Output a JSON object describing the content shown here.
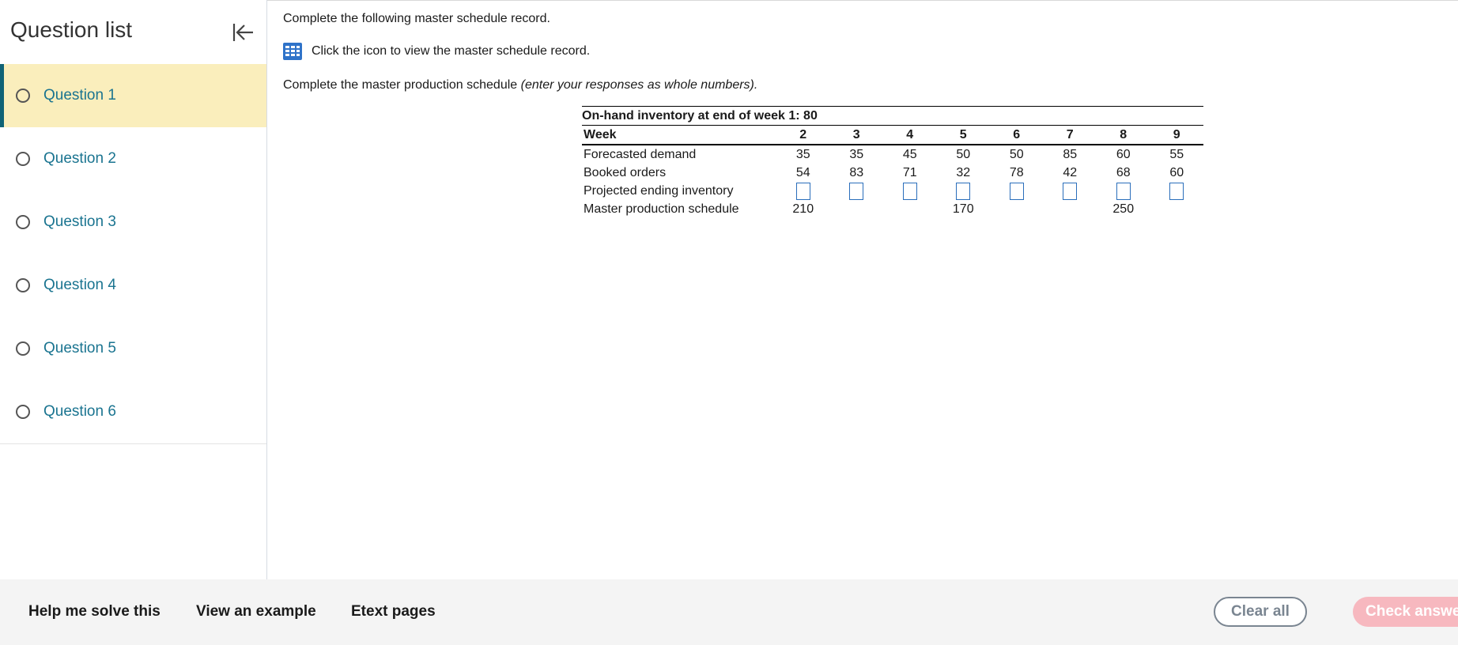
{
  "sidebar": {
    "title": "Question list",
    "collapse_icon": "collapse-left-icon",
    "items": [
      {
        "label": "Question 1",
        "active": true
      },
      {
        "label": "Question 2",
        "active": false
      },
      {
        "label": "Question 3",
        "active": false
      },
      {
        "label": "Question 4",
        "active": false
      },
      {
        "label": "Question 5",
        "active": false
      },
      {
        "label": "Question 6",
        "active": false
      }
    ]
  },
  "main": {
    "instruction": "Complete the following master schedule record.",
    "icon_text": "Click the icon to view the master schedule record.",
    "icon_name": "table-grid-icon",
    "task_text": "Complete the master production schedule",
    "task_hint": "(enter your responses as whole numbers)."
  },
  "table": {
    "onhand_header": "On-hand inventory at end of week 1: 80",
    "week_label": "Week",
    "weeks": [
      "2",
      "3",
      "4",
      "5",
      "6",
      "7",
      "8",
      "9"
    ],
    "rows": {
      "forecast": {
        "label": "Forecasted demand",
        "values": [
          "35",
          "35",
          "45",
          "50",
          "50",
          "85",
          "60",
          "55"
        ]
      },
      "booked": {
        "label": "Booked orders",
        "values": [
          "54",
          "83",
          "71",
          "32",
          "78",
          "42",
          "68",
          "60"
        ]
      },
      "inventory": {
        "label": "Projected ending inventory",
        "values": [
          "",
          "",
          "",
          "",
          "",
          "",
          "",
          ""
        ]
      },
      "mps": {
        "label": "Master production schedule",
        "values": [
          "210",
          "",
          "",
          "170",
          "",
          "",
          "250",
          ""
        ]
      }
    }
  },
  "footer": {
    "help": "Help me solve this",
    "example": "View an example",
    "etext": "Etext pages",
    "clear": "Clear all",
    "check": "Check answer"
  },
  "colors": {
    "accent_teal": "#106376",
    "question_link": "#1a7490",
    "active_bg": "#faeebc",
    "check_button": "#f7b8bf",
    "input_border": "#2a6ebb"
  }
}
